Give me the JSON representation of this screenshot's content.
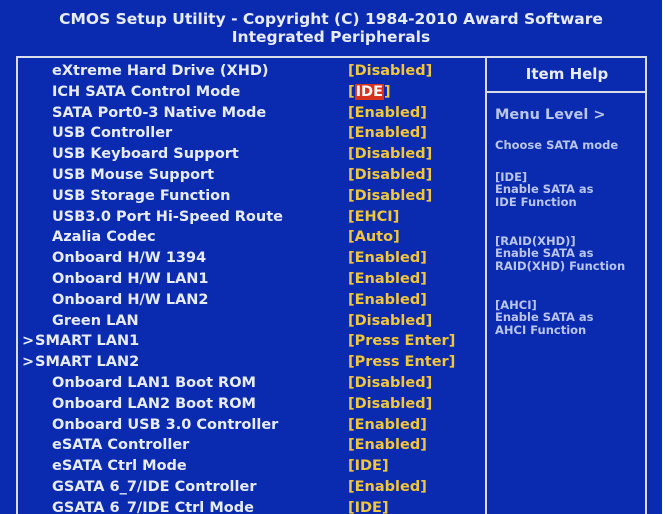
{
  "header": {
    "title": "CMOS Setup Utility - Copyright (C) 1984-2010 Award Software",
    "subtitle": "Integrated Peripherals"
  },
  "settings": [
    {
      "label": "eXtreme Hard Drive (XHD)",
      "value": "[Disabled]"
    },
    {
      "label": "ICH SATA Control Mode",
      "value": "[IDE]",
      "selected": true
    },
    {
      "label": "SATA Port0-3 Native Mode",
      "value": "[Enabled]"
    },
    {
      "label": "USB Controller",
      "value": "[Enabled]"
    },
    {
      "label": "USB Keyboard Support",
      "value": "[Disabled]"
    },
    {
      "label": "USB Mouse Support",
      "value": "[Disabled]"
    },
    {
      "label": "USB Storage Function",
      "value": "[Disabled]"
    },
    {
      "label": "USB3.0 Port Hi-Speed Route",
      "value": "[EHCI]"
    },
    {
      "label": "Azalia Codec",
      "value": "[Auto]"
    },
    {
      "label": "Onboard H/W 1394",
      "value": "[Enabled]"
    },
    {
      "label": "Onboard H/W LAN1",
      "value": "[Enabled]"
    },
    {
      "label": "Onboard H/W LAN2",
      "value": "[Enabled]"
    },
    {
      "label": "Green LAN",
      "value": "[Disabled]"
    },
    {
      "label": "SMART LAN1",
      "value": "[Press Enter]",
      "submenu": true,
      "arrow": ">"
    },
    {
      "label": "SMART LAN2",
      "value": "[Press Enter]",
      "submenu": true,
      "arrow": ">"
    },
    {
      "label": "Onboard LAN1 Boot ROM",
      "value": "[Disabled]"
    },
    {
      "label": "Onboard LAN2 Boot ROM",
      "value": "[Disabled]"
    },
    {
      "label": "Onboard USB 3.0 Controller",
      "value": "[Enabled]"
    },
    {
      "label": "eSATA Controller",
      "value": "[Enabled]"
    },
    {
      "label": "eSATA Ctrl Mode",
      "value": "[IDE]"
    },
    {
      "label": "GSATA 6_7/IDE Controller",
      "value": "[Enabled]"
    },
    {
      "label": "GSATA 6_7/IDE Ctrl Mode",
      "value": "[IDE]"
    }
  ],
  "help": {
    "title": "Item Help",
    "menu_level": "Menu Level  >",
    "description": "Choose SATA mode",
    "options": [
      {
        "key": "[IDE]",
        "text_lines": [
          "Enable SATA as",
          "IDE Function"
        ]
      },
      {
        "key": "[RAID(XHD)]",
        "text_lines": [
          "Enable SATA as",
          "RAID(XHD) Function"
        ]
      },
      {
        "key": "[AHCI]",
        "text_lines": [
          "Enable SATA as",
          "AHCI Function"
        ]
      }
    ]
  },
  "colors": {
    "background": "#0a2bb0",
    "label_text": "#e8ecf6",
    "value_text": "#f2c63a",
    "selection_highlight": "#d8321e",
    "help_text": "#b9c5ea"
  }
}
